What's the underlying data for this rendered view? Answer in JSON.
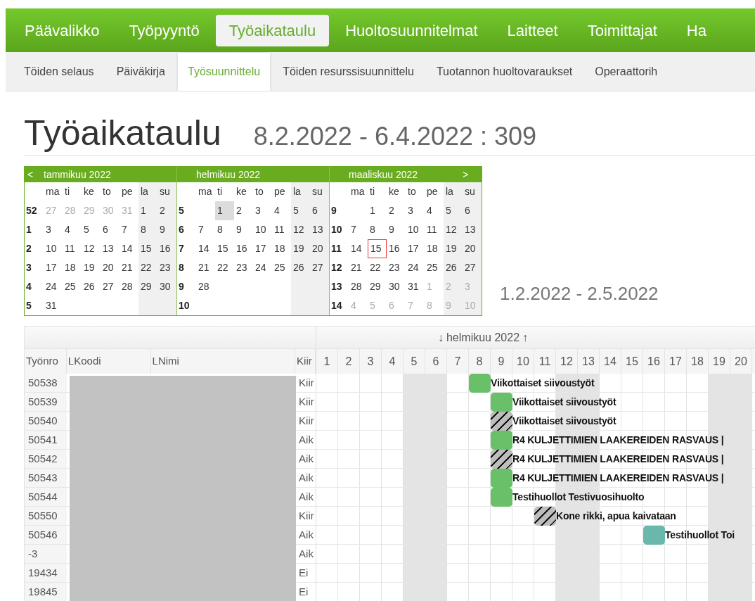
{
  "main_nav": [
    {
      "label": "Päävalikko",
      "selected": false
    },
    {
      "label": "Työpyyntö",
      "selected": false
    },
    {
      "label": "Työaikataulu",
      "selected": true
    },
    {
      "label": "Huoltosuunnitelmat",
      "selected": false
    },
    {
      "label": "Laitteet",
      "selected": false
    },
    {
      "label": "Toimittajat",
      "selected": false
    },
    {
      "label": "Ha",
      "selected": false
    }
  ],
  "sub_nav": [
    {
      "label": "Töiden selaus",
      "selected": false
    },
    {
      "label": "Päiväkirja",
      "selected": false
    },
    {
      "label": "Työsuunnittelu",
      "selected": true
    },
    {
      "label": "Töiden resurssisuunnittelu",
      "selected": false
    },
    {
      "label": "Tuotannon huoltovaraukset",
      "selected": false
    },
    {
      "label": "Operaattorih",
      "selected": false
    }
  ],
  "title": "Työaikataulu",
  "subtitle": "8.2.2022 - 6.4.2022 : 309",
  "calendar": {
    "prev": "<",
    "next": ">",
    "months": [
      {
        "title": "tammikuu 2022",
        "weekdays": [
          "ma",
          "ti",
          "ke",
          "to",
          "pe",
          "la",
          "su"
        ],
        "weeks": [
          {
            "week": "52",
            "days": [
              {
                "d": "27",
                "kind": "other"
              },
              {
                "d": "28",
                "kind": "other"
              },
              {
                "d": "29",
                "kind": "other"
              },
              {
                "d": "30",
                "kind": "other"
              },
              {
                "d": "31",
                "kind": "other"
              },
              {
                "d": "1",
                "kind": "day"
              },
              {
                "d": "2",
                "kind": "day"
              }
            ]
          },
          {
            "week": "1",
            "days": [
              {
                "d": "3",
                "kind": "day"
              },
              {
                "d": "4",
                "kind": "day"
              },
              {
                "d": "5",
                "kind": "day"
              },
              {
                "d": "6",
                "kind": "day"
              },
              {
                "d": "7",
                "kind": "day"
              },
              {
                "d": "8",
                "kind": "day"
              },
              {
                "d": "9",
                "kind": "day"
              }
            ]
          },
          {
            "week": "2",
            "days": [
              {
                "d": "10",
                "kind": "day"
              },
              {
                "d": "11",
                "kind": "day"
              },
              {
                "d": "12",
                "kind": "day"
              },
              {
                "d": "13",
                "kind": "day"
              },
              {
                "d": "14",
                "kind": "day"
              },
              {
                "d": "15",
                "kind": "day"
              },
              {
                "d": "16",
                "kind": "day"
              }
            ]
          },
          {
            "week": "3",
            "days": [
              {
                "d": "17",
                "kind": "day"
              },
              {
                "d": "18",
                "kind": "day"
              },
              {
                "d": "19",
                "kind": "day"
              },
              {
                "d": "20",
                "kind": "day"
              },
              {
                "d": "21",
                "kind": "day"
              },
              {
                "d": "22",
                "kind": "day"
              },
              {
                "d": "23",
                "kind": "day"
              }
            ]
          },
          {
            "week": "4",
            "days": [
              {
                "d": "24",
                "kind": "day"
              },
              {
                "d": "25",
                "kind": "day"
              },
              {
                "d": "26",
                "kind": "day"
              },
              {
                "d": "27",
                "kind": "day"
              },
              {
                "d": "28",
                "kind": "day"
              },
              {
                "d": "29",
                "kind": "day"
              },
              {
                "d": "30",
                "kind": "day"
              }
            ]
          },
          {
            "week": "5",
            "days": [
              {
                "d": "31",
                "kind": "day"
              },
              {
                "kind": "blank"
              },
              {
                "kind": "blank"
              },
              {
                "kind": "blank"
              },
              {
                "kind": "blank"
              },
              {
                "kind": "blank"
              },
              {
                "kind": "blank"
              }
            ]
          }
        ]
      },
      {
        "title": "helmikuu 2022",
        "weekdays": [
          "ma",
          "ti",
          "ke",
          "to",
          "pe",
          "la",
          "su"
        ],
        "weeks": [
          {
            "week": "5",
            "days": [
              {
                "kind": "blank"
              },
              {
                "d": "1",
                "kind": "selected"
              },
              {
                "d": "2",
                "kind": "day"
              },
              {
                "d": "3",
                "kind": "day"
              },
              {
                "d": "4",
                "kind": "day"
              },
              {
                "d": "5",
                "kind": "day"
              },
              {
                "d": "6",
                "kind": "day"
              }
            ]
          },
          {
            "week": "6",
            "days": [
              {
                "d": "7",
                "kind": "day"
              },
              {
                "d": "8",
                "kind": "day"
              },
              {
                "d": "9",
                "kind": "day"
              },
              {
                "d": "10",
                "kind": "day"
              },
              {
                "d": "11",
                "kind": "day"
              },
              {
                "d": "12",
                "kind": "day"
              },
              {
                "d": "13",
                "kind": "day"
              }
            ]
          },
          {
            "week": "7",
            "days": [
              {
                "d": "14",
                "kind": "day"
              },
              {
                "d": "15",
                "kind": "day"
              },
              {
                "d": "16",
                "kind": "day"
              },
              {
                "d": "17",
                "kind": "day"
              },
              {
                "d": "18",
                "kind": "day"
              },
              {
                "d": "19",
                "kind": "day"
              },
              {
                "d": "20",
                "kind": "day"
              }
            ]
          },
          {
            "week": "8",
            "days": [
              {
                "d": "21",
                "kind": "day"
              },
              {
                "d": "22",
                "kind": "day"
              },
              {
                "d": "23",
                "kind": "day"
              },
              {
                "d": "24",
                "kind": "day"
              },
              {
                "d": "25",
                "kind": "day"
              },
              {
                "d": "26",
                "kind": "day"
              },
              {
                "d": "27",
                "kind": "day"
              }
            ]
          },
          {
            "week": "9",
            "days": [
              {
                "d": "28",
                "kind": "day"
              },
              {
                "kind": "blank"
              },
              {
                "kind": "blank"
              },
              {
                "kind": "blank"
              },
              {
                "kind": "blank"
              },
              {
                "kind": "blank"
              },
              {
                "kind": "blank"
              }
            ]
          },
          {
            "week": "10",
            "days": [
              {
                "kind": "blank"
              },
              {
                "kind": "blank"
              },
              {
                "kind": "blank"
              },
              {
                "kind": "blank"
              },
              {
                "kind": "blank"
              },
              {
                "kind": "blank"
              },
              {
                "kind": "blank"
              }
            ]
          }
        ]
      },
      {
        "title": "maaliskuu 2022",
        "weekdays": [
          "ma",
          "ti",
          "ke",
          "to",
          "pe",
          "la",
          "su"
        ],
        "weeks": [
          {
            "week": "9",
            "days": [
              {
                "kind": "blank"
              },
              {
                "d": "1",
                "kind": "day"
              },
              {
                "d": "2",
                "kind": "day"
              },
              {
                "d": "3",
                "kind": "day"
              },
              {
                "d": "4",
                "kind": "day"
              },
              {
                "d": "5",
                "kind": "day"
              },
              {
                "d": "6",
                "kind": "day"
              }
            ]
          },
          {
            "week": "10",
            "days": [
              {
                "d": "7",
                "kind": "day"
              },
              {
                "d": "8",
                "kind": "day"
              },
              {
                "d": "9",
                "kind": "day"
              },
              {
                "d": "10",
                "kind": "day"
              },
              {
                "d": "11",
                "kind": "day"
              },
              {
                "d": "12",
                "kind": "day"
              },
              {
                "d": "13",
                "kind": "day"
              }
            ]
          },
          {
            "week": "11",
            "days": [
              {
                "d": "14",
                "kind": "day"
              },
              {
                "d": "15",
                "kind": "today"
              },
              {
                "d": "16",
                "kind": "day"
              },
              {
                "d": "17",
                "kind": "day"
              },
              {
                "d": "18",
                "kind": "day"
              },
              {
                "d": "19",
                "kind": "day"
              },
              {
                "d": "20",
                "kind": "day"
              }
            ]
          },
          {
            "week": "12",
            "days": [
              {
                "d": "21",
                "kind": "day"
              },
              {
                "d": "22",
                "kind": "day"
              },
              {
                "d": "23",
                "kind": "day"
              },
              {
                "d": "24",
                "kind": "day"
              },
              {
                "d": "25",
                "kind": "day"
              },
              {
                "d": "26",
                "kind": "day"
              },
              {
                "d": "27",
                "kind": "day"
              }
            ]
          },
          {
            "week": "13",
            "days": [
              {
                "d": "28",
                "kind": "day"
              },
              {
                "d": "29",
                "kind": "day"
              },
              {
                "d": "30",
                "kind": "day"
              },
              {
                "d": "31",
                "kind": "day"
              },
              {
                "d": "1",
                "kind": "other"
              },
              {
                "d": "2",
                "kind": "other"
              },
              {
                "d": "3",
                "kind": "other"
              }
            ]
          },
          {
            "week": "14",
            "days": [
              {
                "d": "4",
                "kind": "other"
              },
              {
                "d": "5",
                "kind": "other"
              },
              {
                "d": "6",
                "kind": "other"
              },
              {
                "d": "7",
                "kind": "other"
              },
              {
                "d": "8",
                "kind": "other"
              },
              {
                "d": "9",
                "kind": "other"
              },
              {
                "d": "10",
                "kind": "other"
              }
            ]
          }
        ]
      }
    ]
  },
  "range": "1.2.2022 - 2.5.2022",
  "gantt": {
    "month_prev": "↓",
    "month": "helmikuu 2022",
    "month_next": "↑",
    "columns": [
      "Työnro",
      "LKoodi",
      "LNimi",
      "Kiir"
    ],
    "days": [
      {
        "label": "1",
        "weekend": false
      },
      {
        "label": "2",
        "weekend": false
      },
      {
        "label": "3",
        "weekend": false
      },
      {
        "label": "4",
        "weekend": false
      },
      {
        "label": "5",
        "weekend": true
      },
      {
        "label": "6",
        "weekend": true
      },
      {
        "label": "7",
        "weekend": false
      },
      {
        "label": "8",
        "weekend": false
      },
      {
        "label": "9",
        "weekend": false
      },
      {
        "label": "10",
        "weekend": false
      },
      {
        "label": "11",
        "weekend": false
      },
      {
        "label": "12",
        "weekend": true
      },
      {
        "label": "13",
        "weekend": true
      },
      {
        "label": "14",
        "weekend": false
      },
      {
        "label": "15",
        "weekend": false
      },
      {
        "label": "16",
        "weekend": false
      },
      {
        "label": "17",
        "weekend": false
      },
      {
        "label": "18",
        "weekend": false
      },
      {
        "label": "19",
        "weekend": true
      },
      {
        "label": "20",
        "weekend": true
      }
    ],
    "rows": [
      {
        "number": "50538",
        "priority": "Kiir",
        "cells": [
          {
            "kind": "empty"
          },
          {
            "kind": "empty"
          },
          {
            "kind": "empty"
          },
          {
            "kind": "empty"
          },
          {
            "kind": "empty"
          },
          {
            "kind": "empty"
          },
          {
            "kind": "empty"
          },
          {
            "kind": "solid",
            "color": "#6abf69",
            "label": "Viikottaiset siivoustyöt"
          }
        ]
      },
      {
        "number": "50539",
        "priority": "Kiir",
        "cells": [
          {
            "kind": "empty"
          },
          {
            "kind": "empty"
          },
          {
            "kind": "empty"
          },
          {
            "kind": "empty"
          },
          {
            "kind": "empty"
          },
          {
            "kind": "empty"
          },
          {
            "kind": "empty"
          },
          {
            "kind": "empty"
          },
          {
            "kind": "solid",
            "color": "#6abf69",
            "label": "Viikottaiset siivoustyöt"
          }
        ]
      },
      {
        "number": "50540",
        "priority": "Kiir",
        "cells": [
          {
            "kind": "empty"
          },
          {
            "kind": "empty"
          },
          {
            "kind": "empty"
          },
          {
            "kind": "empty"
          },
          {
            "kind": "empty"
          },
          {
            "kind": "empty"
          },
          {
            "kind": "empty"
          },
          {
            "kind": "empty"
          },
          {
            "kind": "striped",
            "label": "Viikottaiset siivoustyöt"
          }
        ]
      },
      {
        "number": "50541",
        "priority": "Aik",
        "cells": [
          {
            "kind": "empty"
          },
          {
            "kind": "empty"
          },
          {
            "kind": "empty"
          },
          {
            "kind": "empty"
          },
          {
            "kind": "empty"
          },
          {
            "kind": "empty"
          },
          {
            "kind": "empty"
          },
          {
            "kind": "empty"
          },
          {
            "kind": "solid",
            "color": "#6abf69",
            "label": "R4 KULJETTIMIEN LAAKEREIDEN RASVAUS |"
          }
        ]
      },
      {
        "number": "50542",
        "priority": "Aik",
        "cells": [
          {
            "kind": "empty"
          },
          {
            "kind": "empty"
          },
          {
            "kind": "empty"
          },
          {
            "kind": "empty"
          },
          {
            "kind": "empty"
          },
          {
            "kind": "empty"
          },
          {
            "kind": "empty"
          },
          {
            "kind": "empty"
          },
          {
            "kind": "striped",
            "label": "R4 KULJETTIMIEN LAAKEREIDEN RASVAUS |"
          }
        ]
      },
      {
        "number": "50543",
        "priority": "Aik",
        "cells": [
          {
            "kind": "empty"
          },
          {
            "kind": "empty"
          },
          {
            "kind": "empty"
          },
          {
            "kind": "empty"
          },
          {
            "kind": "empty"
          },
          {
            "kind": "empty"
          },
          {
            "kind": "empty"
          },
          {
            "kind": "empty"
          },
          {
            "kind": "solid",
            "color": "#6abf69",
            "label": "R4 KULJETTIMIEN LAAKEREIDEN RASVAUS |"
          }
        ]
      },
      {
        "number": "50544",
        "priority": "Aik",
        "cells": [
          {
            "kind": "empty"
          },
          {
            "kind": "empty"
          },
          {
            "kind": "empty"
          },
          {
            "kind": "empty"
          },
          {
            "kind": "empty"
          },
          {
            "kind": "empty"
          },
          {
            "kind": "empty"
          },
          {
            "kind": "empty"
          },
          {
            "kind": "solid",
            "color": "#6abf69",
            "label": "Testihuollot Testivuosihuolto"
          }
        ]
      },
      {
        "number": "50550",
        "priority": "Kiir",
        "cells": [
          {
            "kind": "empty"
          },
          {
            "kind": "empty"
          },
          {
            "kind": "empty"
          },
          {
            "kind": "empty"
          },
          {
            "kind": "empty"
          },
          {
            "kind": "empty"
          },
          {
            "kind": "empty"
          },
          {
            "kind": "empty"
          },
          {
            "kind": "empty"
          },
          {
            "kind": "empty"
          },
          {
            "kind": "striped",
            "label": "Kone rikki, apua kaivataan"
          }
        ]
      },
      {
        "number": "50546",
        "priority": "Aik",
        "cells": [
          {
            "kind": "empty"
          },
          {
            "kind": "empty"
          },
          {
            "kind": "empty"
          },
          {
            "kind": "empty"
          },
          {
            "kind": "empty"
          },
          {
            "kind": "empty"
          },
          {
            "kind": "empty"
          },
          {
            "kind": "empty"
          },
          {
            "kind": "empty"
          },
          {
            "kind": "empty"
          },
          {
            "kind": "empty"
          },
          {
            "kind": "empty"
          },
          {
            "kind": "empty"
          },
          {
            "kind": "empty"
          },
          {
            "kind": "empty"
          },
          {
            "kind": "solid",
            "color": "#6ab8ac",
            "label": "Testihuollot Toi"
          }
        ]
      },
      {
        "number": "-3",
        "priority": "Aik"
      },
      {
        "number": "19434",
        "priority": "Ei"
      },
      {
        "number": "19845",
        "priority": "Ei"
      }
    ]
  }
}
